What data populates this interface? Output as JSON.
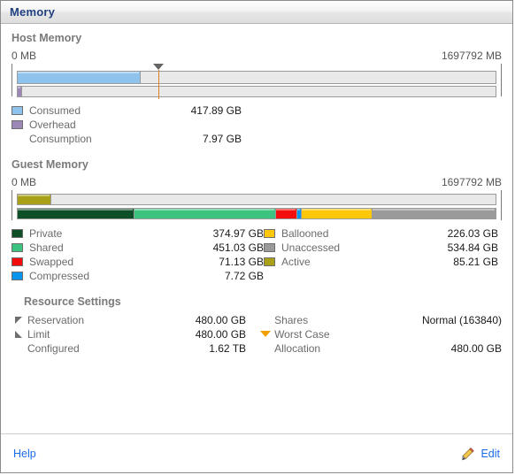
{
  "panel": {
    "title": "Memory"
  },
  "host": {
    "heading": "Host Memory",
    "scale_min": "0 MB",
    "scale_max": "1697792 MB",
    "legend": [
      {
        "label": "Consumed",
        "value": "417.89 GB",
        "color": "#8dc3ec"
      },
      {
        "label": "Overhead",
        "value": "",
        "color": "#9b87b8"
      },
      {
        "label": "Consumption",
        "value": "7.97 GB",
        "color": ""
      }
    ],
    "bar": {
      "consumed_pct": 25.7,
      "overhead_pct": 0.9,
      "marker_pct": 30.0
    }
  },
  "guest": {
    "heading": "Guest Memory",
    "scale_min": "0 MB",
    "scale_max": "1697792 MB",
    "legend_left": [
      {
        "label": "Private",
        "value": "374.97 GB",
        "color": "#0d4f26"
      },
      {
        "label": "Shared",
        "value": "451.03 GB",
        "color": "#3bc37f"
      },
      {
        "label": "Swapped",
        "value": "71.13 GB",
        "color": "#f40d0d"
      },
      {
        "label": "Compressed",
        "value": "7.72 GB",
        "color": "#0a95ec"
      }
    ],
    "legend_right": [
      {
        "label": "Ballooned",
        "value": "226.03 GB",
        "color": "#ffc709"
      },
      {
        "label": "Unaccessed",
        "value": "534.84 GB",
        "color": "#9a9a9a"
      },
      {
        "label": "Active",
        "value": "85.21 GB",
        "color": "#a8a017"
      }
    ],
    "bar": {
      "active_pct": 7.0,
      "private_pct": 24.5,
      "shared_pct": 29.5,
      "swapped_pct": 4.6,
      "compressed_pct": 0.9,
      "ballooned_pct": 14.8,
      "unaccessed_pct": 25.7
    }
  },
  "resource_settings": {
    "heading": "Resource Settings",
    "rows": [
      {
        "icon": "reservation-marker-icon",
        "label": "Reservation",
        "value": "480.00 GB",
        "label2": "Shares",
        "value2": "Normal (163840)"
      },
      {
        "icon": "limit-marker-icon",
        "label": "Limit",
        "value": "480.00 GB",
        "label2": "Worst Case",
        "value2": ""
      },
      {
        "icon": "",
        "label": "Configured",
        "value": "1.62 TB",
        "label2": "Allocation",
        "value2": "480.00 GB"
      }
    ]
  },
  "footer": {
    "help_label": "Help",
    "edit_label": "Edit",
    "edit_icon": "pencil-icon",
    "link_color": "#1a6ce8"
  }
}
